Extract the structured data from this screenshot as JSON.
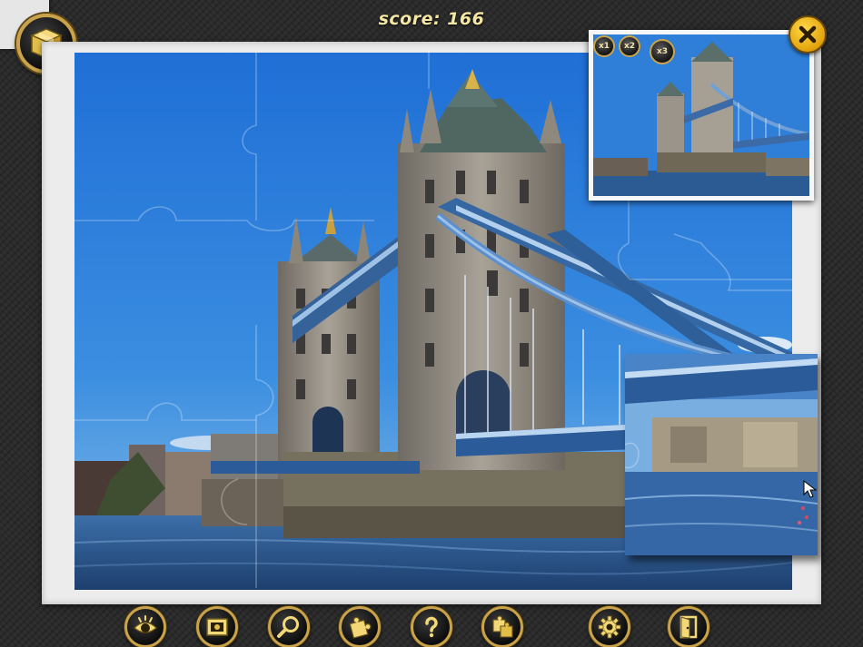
{
  "header": {
    "score_text": "score: 166"
  },
  "preview": {
    "zoom_options": [
      "x1",
      "x2",
      "x3"
    ]
  },
  "colors": {
    "frame_gold": "#c9a24a",
    "score_text": "#f4e7a4",
    "close_button": "#f0b81c",
    "sky": "#2f7fd8",
    "water": "#2d5d9a"
  },
  "toolbar": {
    "buttons": [
      {
        "name": "show-image",
        "icon": "eye-icon"
      },
      {
        "name": "background",
        "icon": "picture-frame-icon"
      },
      {
        "name": "magnifier",
        "icon": "magnifier-icon"
      },
      {
        "name": "edge-pieces",
        "icon": "puzzle-pieces-icon"
      },
      {
        "name": "help",
        "icon": "question-icon"
      },
      {
        "name": "sort-pieces",
        "icon": "puzzle-sort-icon"
      },
      {
        "name": "settings",
        "icon": "gear-icon"
      },
      {
        "name": "exit",
        "icon": "exit-door-icon"
      }
    ]
  }
}
